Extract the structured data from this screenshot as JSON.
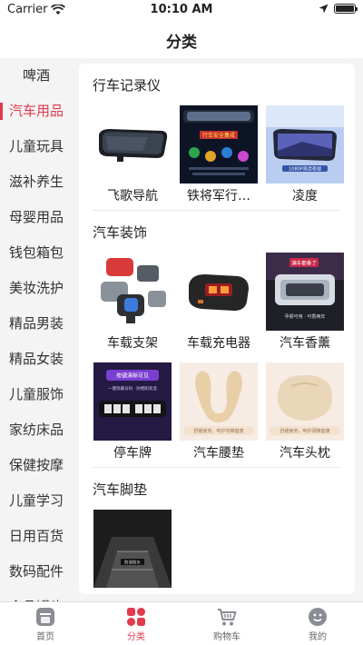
{
  "status": {
    "carrier": "Carrier",
    "time": "10:10 AM"
  },
  "nav": {
    "title": "分类"
  },
  "sidebar": {
    "items": [
      {
        "label": "啤酒",
        "active": false
      },
      {
        "label": "汽车用品",
        "active": true
      },
      {
        "label": "儿童玩具",
        "active": false
      },
      {
        "label": "滋补养生",
        "active": false
      },
      {
        "label": "母婴用品",
        "active": false
      },
      {
        "label": "钱包箱包",
        "active": false
      },
      {
        "label": "美妆洗护",
        "active": false
      },
      {
        "label": "精品男装",
        "active": false
      },
      {
        "label": "精品女装",
        "active": false
      },
      {
        "label": "儿童服饰",
        "active": false
      },
      {
        "label": "家纺床品",
        "active": false
      },
      {
        "label": "保健按摩",
        "active": false
      },
      {
        "label": "儿童学习",
        "active": false
      },
      {
        "label": "日用百货",
        "active": false
      },
      {
        "label": "数码配件",
        "active": false
      },
      {
        "label": "食品罐头",
        "active": false
      }
    ]
  },
  "sections": [
    {
      "title": "行车记录仪",
      "items": [
        {
          "label": "飞歌导航"
        },
        {
          "label": "铁将军行…"
        },
        {
          "label": "凌度"
        }
      ]
    },
    {
      "title": "汽车装饰",
      "items": [
        {
          "label": "车载支架"
        },
        {
          "label": "车载充电器"
        },
        {
          "label": "汽车香薰"
        },
        {
          "label": "停车牌"
        },
        {
          "label": "汽车腰垫"
        },
        {
          "label": "汽车头枕"
        }
      ]
    },
    {
      "title": "汽车脚垫",
      "items": [
        {
          "label": ""
        }
      ]
    }
  ],
  "thumb_text": {
    "dashcam2_badge": "行车安全集成",
    "dashcam3_caption": "1080P高清夜视",
    "fragrance_tag": "满车都香了",
    "fragrance_caption": "孕婴可用 · 可香两年",
    "parking_title": "按键清晰可见",
    "parking_caption": "一键隐藏号码 · 防晒耐高温",
    "lumbar_caption": "舒缓疲劳，呵护背椎健康",
    "headrest_caption": "舒缓疲劳，呵护颈椎健康",
    "floormat_tag": "防滑防水"
  },
  "tabs": [
    {
      "label": "首页",
      "icon": "home-icon",
      "active": false
    },
    {
      "label": "分类",
      "icon": "category-icon",
      "active": true
    },
    {
      "label": "购物车",
      "icon": "cart-icon",
      "active": false
    },
    {
      "label": "我的",
      "icon": "profile-icon",
      "active": false
    }
  ],
  "colors": {
    "accent": "#e03a4b",
    "background": "#f4f4f4"
  }
}
